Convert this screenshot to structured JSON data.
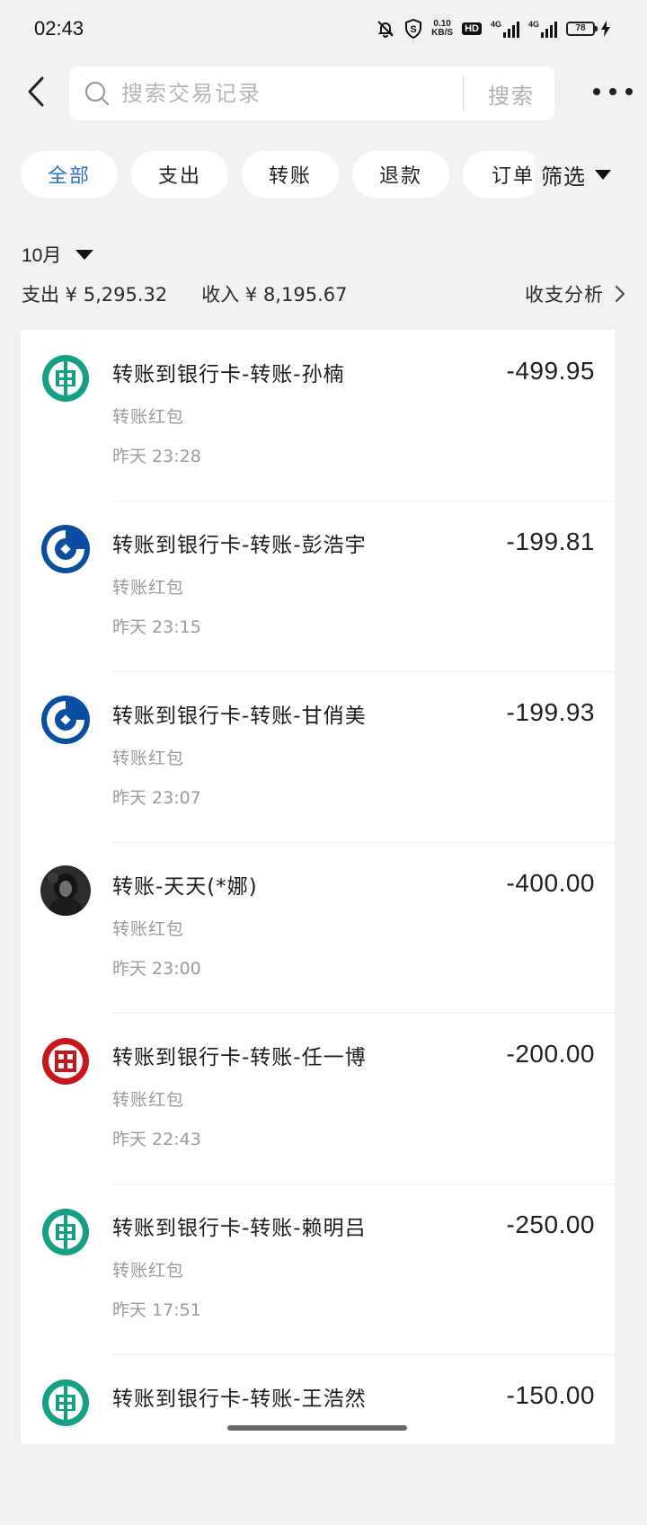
{
  "status_bar": {
    "time": "02:43",
    "speed_top": "0.10",
    "speed_bottom": "KB/S",
    "hd": "HD",
    "net1": "4G",
    "net2": "4G",
    "battery": "78"
  },
  "header": {
    "search_placeholder": "搜索交易记录",
    "search_button": "搜索"
  },
  "chips": [
    {
      "label": "全部",
      "active": true
    },
    {
      "label": "支出",
      "active": false
    },
    {
      "label": "转账",
      "active": false
    },
    {
      "label": "退款",
      "active": false
    },
    {
      "label": "订单",
      "active": false
    }
  ],
  "filter_label": "筛选",
  "month": "10月",
  "summary": {
    "expense": "支出 ¥ 5,295.32",
    "income": "收入 ¥ 8,195.67",
    "analysis": "收支分析"
  },
  "transactions": [
    {
      "title": "转账到银行卡-转账-孙楠",
      "sub": "转账红包",
      "time": "昨天 23:28",
      "amount": "-499.95",
      "icon": "abc-bank-icon"
    },
    {
      "title": "转账到银行卡-转账-彭浩宇",
      "sub": "转账红包",
      "time": "昨天 23:15",
      "amount": "-199.81",
      "icon": "ccb-bank-icon"
    },
    {
      "title": "转账到银行卡-转账-甘俏美",
      "sub": "转账红包",
      "time": "昨天 23:07",
      "amount": "-199.93",
      "icon": "ccb-bank-icon"
    },
    {
      "title": "转账-天天(*娜)",
      "sub": "转账红包",
      "time": "昨天 23:00",
      "amount": "-400.00",
      "icon": "user-avatar"
    },
    {
      "title": "转账到银行卡-转账-任一博",
      "sub": "转账红包",
      "time": "昨天 22:43",
      "amount": "-200.00",
      "icon": "icbc-bank-icon"
    },
    {
      "title": "转账到银行卡-转账-赖明吕",
      "sub": "转账红包",
      "time": "昨天 17:51",
      "amount": "-250.00",
      "icon": "abc-bank-icon"
    },
    {
      "title": "转账到银行卡-转账-王浩然",
      "sub": "",
      "time": "",
      "amount": "-150.00",
      "icon": "abc-bank-icon"
    }
  ],
  "colors": {
    "background": "#f1f1f1",
    "accent_blue": "#2f6fd8",
    "abc_green": "#13a085",
    "ccb_blue": "#0a4ea2",
    "icbc_red": "#c8161d"
  }
}
